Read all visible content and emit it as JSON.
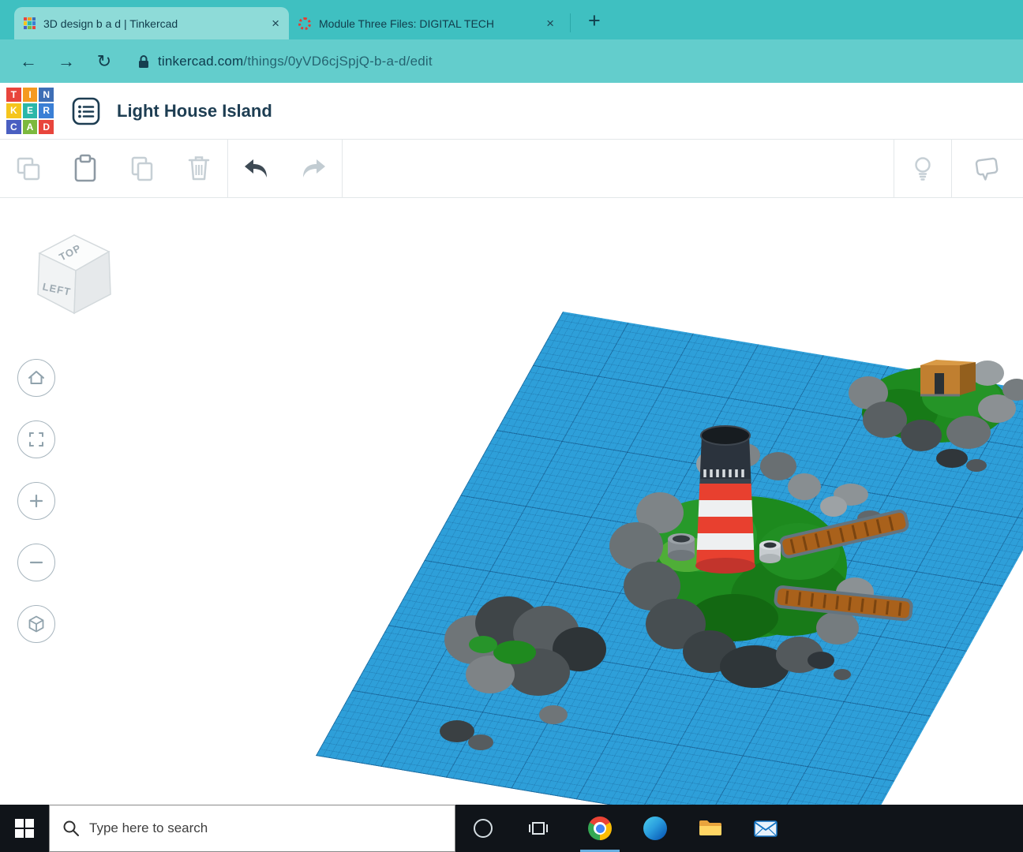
{
  "browser": {
    "tab1": {
      "title": "3D design b a d | Tinkercad",
      "close_label": "×"
    },
    "tab2": {
      "title": "Module Three Files: DIGITAL TECH",
      "close_label": "×"
    },
    "new_tab_label": "+",
    "back_glyph": "←",
    "forward_glyph": "→",
    "reload_glyph": "↻",
    "url_domain": "tinkercad.com",
    "url_path": "/things/0yVD6cjSpjQ-b-a-d/edit"
  },
  "app": {
    "title": "Light House Island",
    "logo_rows": [
      [
        "T",
        "I",
        "N"
      ],
      [
        "K",
        "E",
        "R"
      ],
      [
        "C",
        "A",
        "D"
      ]
    ]
  },
  "toolbar": {
    "icons": [
      "copy",
      "paste",
      "duplicate",
      "delete",
      "undo",
      "redo",
      "tips",
      "notes"
    ]
  },
  "viewcube": {
    "top_label": "TOP",
    "left_label": "LEFT"
  },
  "taskbar": {
    "search_placeholder": "Type here to search"
  },
  "colors": {
    "frame_teal": "#3fc0c1",
    "toolbar_teal": "#63cdcc",
    "active_tab_teal": "#8edbd8",
    "workplane_blue": "#2e9fd9",
    "island_green": "#1d8a1e",
    "lighthouse_red": "#e8402f",
    "pier_brown": "#a9611b",
    "taskbar_black": "#101419"
  }
}
